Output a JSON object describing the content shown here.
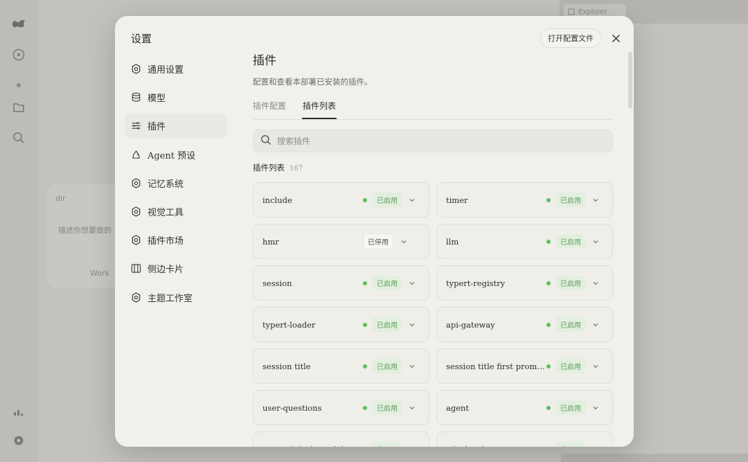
{
  "background": {
    "tab_label": "Explorer",
    "chat_items": [
      "dir",
      "描述你想要做的",
      "Work"
    ]
  },
  "modal": {
    "title": "设置",
    "open_config_label": "打开配置文件",
    "nav": [
      {
        "label": "通用设置",
        "icon": "gear-icon"
      },
      {
        "label": "模型",
        "icon": "database-icon"
      },
      {
        "label": "插件",
        "icon": "sliders-icon",
        "active": true
      },
      {
        "label": "Agent 预设",
        "icon": "recycle-icon"
      },
      {
        "label": "记忆系统",
        "icon": "gear-icon"
      },
      {
        "label": "视觉工具",
        "icon": "gear-icon"
      },
      {
        "label": "插件市场",
        "icon": "gear-icon"
      },
      {
        "label": "侧边卡片",
        "icon": "panel-icon"
      },
      {
        "label": "主题工作室",
        "icon": "gear-icon"
      }
    ],
    "content": {
      "title": "插件",
      "description": "配置和查看本部署已安装的插件。",
      "tabs": [
        {
          "label": "插件配置",
          "active": false
        },
        {
          "label": "插件列表",
          "active": true
        }
      ],
      "search_placeholder": "搜索插件",
      "list_title": "插件列表",
      "list_count": "167",
      "plugins": [
        {
          "name": "include",
          "status": "已启用",
          "enabled": true
        },
        {
          "name": "timer",
          "status": "已启用",
          "enabled": true
        },
        {
          "name": "hmr",
          "status": "已停用",
          "enabled": false
        },
        {
          "name": "llm",
          "status": "已启用",
          "enabled": true
        },
        {
          "name": "session",
          "status": "已启用",
          "enabled": true
        },
        {
          "name": "typert-registry",
          "status": "已启用",
          "enabled": true
        },
        {
          "name": "typert-loader",
          "status": "已启用",
          "enabled": true
        },
        {
          "name": "api-gateway",
          "status": "已启用",
          "enabled": true
        },
        {
          "name": "session title",
          "status": "已启用",
          "enabled": true
        },
        {
          "name": "session title first promp…",
          "status": "已启用",
          "enabled": true
        },
        {
          "name": "user-questions",
          "status": "已启用",
          "enabled": true
        },
        {
          "name": "agent",
          "status": "已启用",
          "enabled": true
        },
        {
          "name": "agent-default-model",
          "status": "已启用",
          "enabled": true
        },
        {
          "name": "jobs-local",
          "status": "已启用",
          "enabled": true
        }
      ]
    }
  },
  "colors": {
    "enabled_dot": "#5cbf5e",
    "enabled_badge_bg": "#e2efdf",
    "enabled_badge_text": "#5fa05b"
  }
}
